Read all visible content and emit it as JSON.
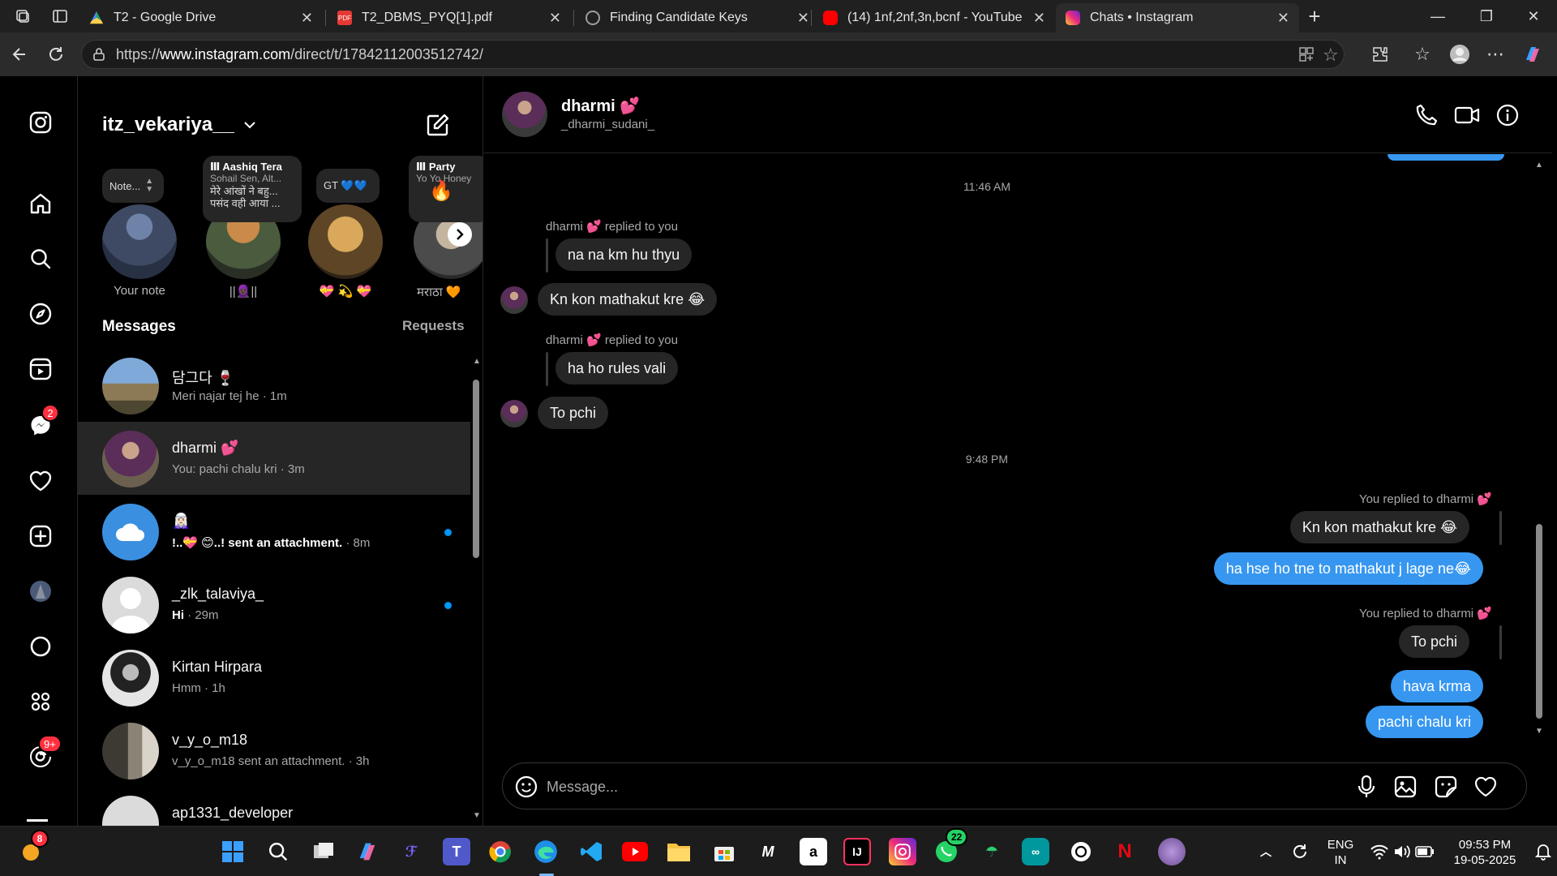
{
  "browser": {
    "tabs": [
      {
        "title": "T2 - Google Drive",
        "favicon_color": "#1fa463"
      },
      {
        "title": "T2_DBMS_PYQ[1].pdf",
        "favicon_color": "#e53935"
      },
      {
        "title": "Finding Candidate Keys",
        "favicon_color": "#9e9e9e"
      },
      {
        "title": "(14) 1nf,2nf,3n,bcnf - YouTube",
        "favicon_color": "#ff0000"
      },
      {
        "title": "Chats • Instagram",
        "favicon_color": "#e1306c"
      }
    ],
    "url_prefix": "https://",
    "url_host": "www.instagram.com",
    "url_path": "/direct/t/17842112003512742/"
  },
  "instagram": {
    "nav_badges": {
      "messages": "2",
      "threads": "9+"
    },
    "inbox": {
      "username": "itz_vekariya__",
      "notes": [
        {
          "bubble": "Note...",
          "label": "Your note"
        },
        {
          "bubble_title": "Aashiq Tera",
          "bubble_artist": "Sohail Sen, Alt...",
          "bubble_lyric1": "मेरे आंखों ने बहु...",
          "bubble_lyric2": "पसंद वही आया ...",
          "label": "||🧕🏿||"
        },
        {
          "bubble": "GT 💙💙",
          "label": "💝 💫 💝"
        },
        {
          "bubble_title": "Party",
          "bubble_artist": "Yo Yo Honey",
          "bubble_emoji": "🔥",
          "label": "मराठा 🧡"
        }
      ],
      "messages_title": "Messages",
      "requests_label": "Requests",
      "conversations": [
        {
          "name": "담그다 🍷",
          "preview": "Meri najar tej he",
          "time": " · 1m",
          "unread": false
        },
        {
          "name": "dharmi 💕",
          "preview": "You: pachi chalu kri",
          "time": " · 3m",
          "unread": false
        },
        {
          "name": "🧝🏻‍♀️",
          "preview": "!..💝 😊..! sent an attachment.",
          "time": " · 8m",
          "unread": true
        },
        {
          "name": "_zlk_talaviya_",
          "preview": "Hi",
          "time": " · 29m",
          "unread": true
        },
        {
          "name": "Kirtan Hirpara",
          "preview": "Hmm",
          "time": " · 1h",
          "unread": false
        },
        {
          "name": "v_y_o_m18",
          "preview": "v_y_o_m18 sent an attachment.",
          "time": " · 3h",
          "unread": false
        },
        {
          "name": "ap1331_developer",
          "preview": "",
          "time": "",
          "unread": false
        }
      ]
    },
    "chat": {
      "name": "dharmi 💕",
      "handle": "_dharmi_sudani_",
      "time1": "11:46 AM",
      "reply_label_them": "dharmi 💕 replied to you",
      "quote1": "na na km hu thyu",
      "msg1": "Kn kon mathakut kre 😂",
      "quote2": "ha ho rules vali",
      "msg2": "To pchi",
      "time2": "9:48 PM",
      "reply_label_me": "You replied to dharmi 💕",
      "my_quote1": "Kn kon mathakut kre 😂",
      "my_msg1": "ha hse ho tne to mathakut j lage ne😂",
      "my_quote2": "To pchi",
      "my_msg2": "hava krma",
      "my_msg3": "pachi chalu kri",
      "composer_placeholder": "Message..."
    }
  },
  "taskbar": {
    "weather_badge": "8",
    "whatsapp_badge": "22",
    "lang_line1": "ENG",
    "lang_line2": "IN",
    "clock_time": "09:53 PM",
    "clock_date": "19-05-2025"
  }
}
